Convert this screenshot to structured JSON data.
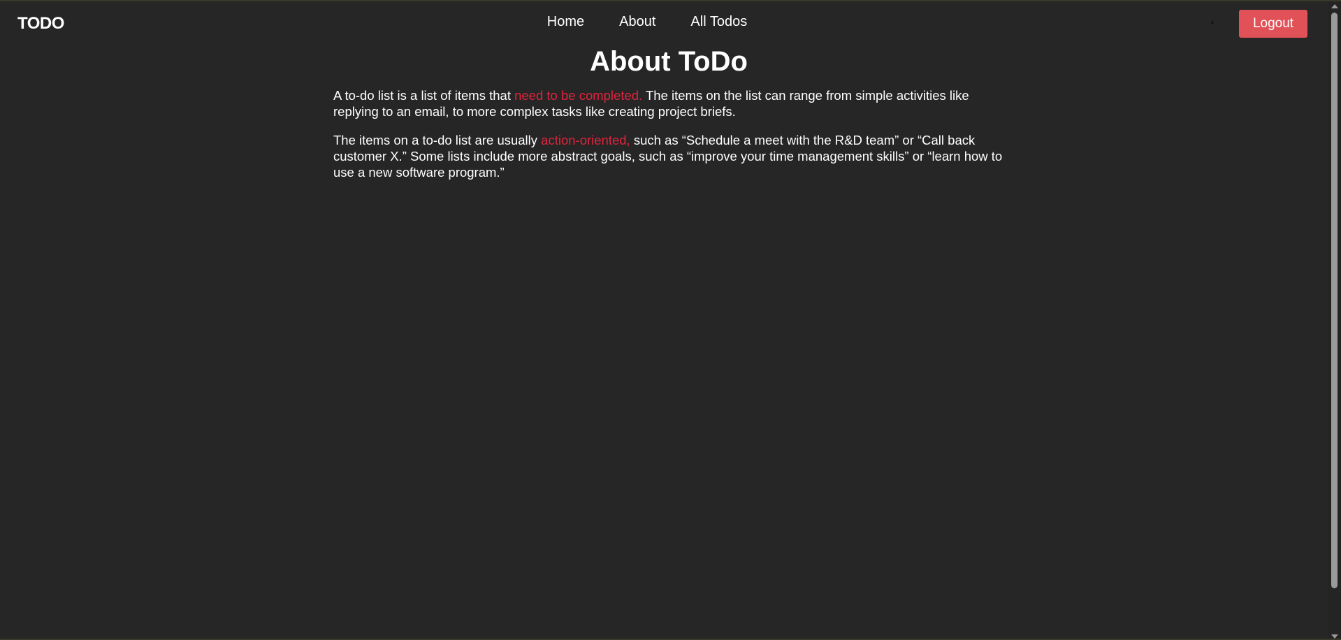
{
  "navbar": {
    "brand": "TODO",
    "links": [
      {
        "label": "Home"
      },
      {
        "label": "About"
      },
      {
        "label": "All Todos"
      }
    ],
    "theme_toggle_icon": "◐",
    "logout_label": "Logout"
  },
  "main": {
    "title": "About ToDo",
    "paragraph1": {
      "before": "A to-do list is a list of items that ",
      "highlight": "need to be completed.",
      "after": " The items on the list can range from simple activities like replying to an email, to more complex tasks like creating project briefs."
    },
    "paragraph2": {
      "before": "The items on a to-do list are usually ",
      "highlight": "action-oriented,",
      "after": " such as “Schedule a meet with the R&D team” or “Call back customer X.” Some lists include more abstract goals, such as “improve your time management skills” or “learn how to use a new software program.”"
    }
  },
  "colors": {
    "background": "#262626",
    "text": "#ffffff",
    "accent_highlight": "#e0243e",
    "logout_button": "#e05257"
  },
  "icons": {
    "theme_toggle": "half-circle-contrast-icon",
    "scroll_up": "triangle-up-icon",
    "scroll_down": "triangle-down-icon"
  }
}
